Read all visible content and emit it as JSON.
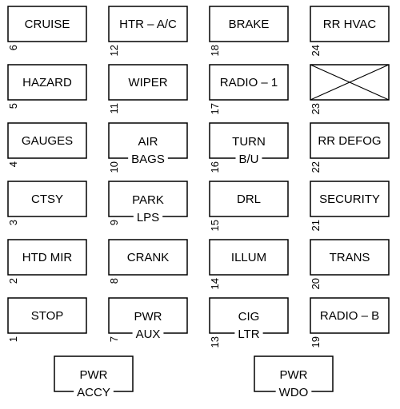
{
  "colors": {
    "line": "#000000",
    "background": "#ffffff"
  },
  "fuses": [
    {
      "number": "6",
      "lines": [
        "CRUISE"
      ]
    },
    {
      "number": "12",
      "lines": [
        "HTR – A/C"
      ]
    },
    {
      "number": "18",
      "lines": [
        "BRAKE"
      ]
    },
    {
      "number": "24",
      "lines": [
        "RR HVAC"
      ]
    },
    {
      "number": "5",
      "lines": [
        "HAZARD"
      ]
    },
    {
      "number": "11",
      "lines": [
        "WIPER"
      ]
    },
    {
      "number": "17",
      "lines": [
        "RADIO – 1"
      ]
    },
    {
      "number": "23",
      "lines": [],
      "empty_slot": true
    },
    {
      "number": "4",
      "lines": [
        "GAUGES"
      ]
    },
    {
      "number": "10",
      "lines": [
        "AIR",
        "BAGS"
      ]
    },
    {
      "number": "16",
      "lines": [
        "TURN",
        "B/U"
      ]
    },
    {
      "number": "22",
      "lines": [
        "RR DEFOG"
      ]
    },
    {
      "number": "3",
      "lines": [
        "CTSY"
      ]
    },
    {
      "number": "9",
      "lines": [
        "PARK",
        "LPS"
      ]
    },
    {
      "number": "15",
      "lines": [
        "DRL"
      ]
    },
    {
      "number": "21",
      "lines": [
        "SECURITY"
      ]
    },
    {
      "number": "2",
      "lines": [
        "HTD MIR"
      ]
    },
    {
      "number": "8",
      "lines": [
        "CRANK"
      ]
    },
    {
      "number": "14",
      "lines": [
        "ILLUM"
      ]
    },
    {
      "number": "20",
      "lines": [
        "TRANS"
      ]
    },
    {
      "number": "1",
      "lines": [
        "STOP"
      ]
    },
    {
      "number": "7",
      "lines": [
        "PWR",
        "AUX"
      ]
    },
    {
      "number": "13",
      "lines": [
        "CIG",
        "LTR"
      ]
    },
    {
      "number": "19",
      "lines": [
        "RADIO – B"
      ]
    }
  ],
  "breakers": [
    {
      "lines": [
        "PWR",
        "ACCY"
      ]
    },
    {
      "lines": [
        "PWR",
        "WDO"
      ]
    }
  ]
}
